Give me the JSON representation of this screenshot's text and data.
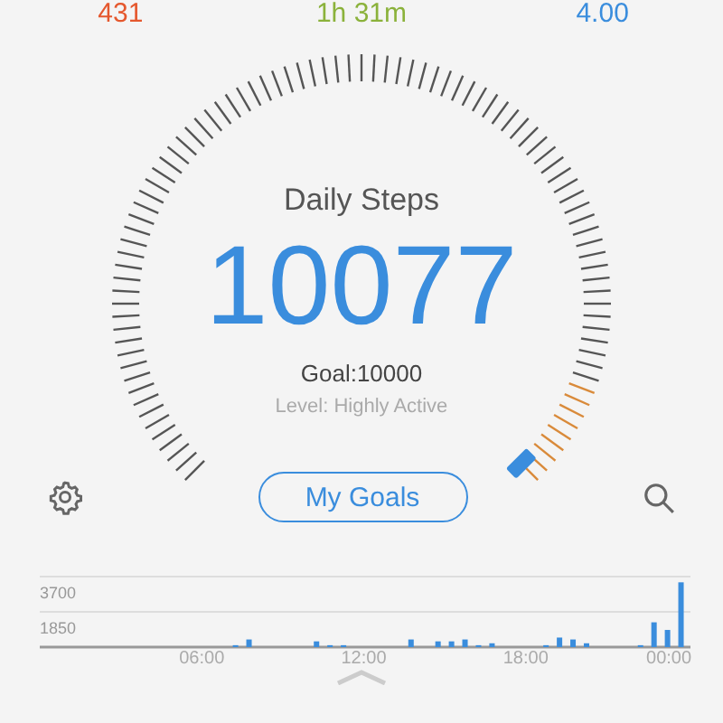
{
  "stats": [
    {
      "value": "431",
      "color": "#e5582e"
    },
    {
      "value": "1h 31m",
      "color": "#8bb23b"
    },
    {
      "value": "4.00",
      "color": "#3a8ddd"
    }
  ],
  "gauge": {
    "title": "Daily Steps",
    "steps": "10077",
    "goal": "Goal:10000",
    "activity": "Level: Highly Active"
  },
  "goals_button": "My Goals",
  "chart_data": {
    "type": "bar",
    "x": [
      7.25,
      7.75,
      10.25,
      10.75,
      11.25,
      13.75,
      14.75,
      15.25,
      15.75,
      16.25,
      16.75,
      18.75,
      19.25,
      19.75,
      20.25,
      22.25,
      22.75,
      23.25,
      23.75
    ],
    "values": [
      100,
      400,
      300,
      100,
      100,
      400,
      300,
      300,
      400,
      100,
      200,
      100,
      500,
      400,
      200,
      100,
      1300,
      900,
      3400
    ],
    "xlim": [
      0,
      24.1
    ],
    "ylim": [
      0,
      3700
    ],
    "yticks": [
      1850,
      3700
    ],
    "xticks": [
      {
        "value": 6,
        "label": "06:00"
      },
      {
        "value": 12,
        "label": "12:00"
      },
      {
        "value": 18,
        "label": "18:00"
      },
      {
        "value": 23.3,
        "label": "00:00"
      }
    ]
  }
}
